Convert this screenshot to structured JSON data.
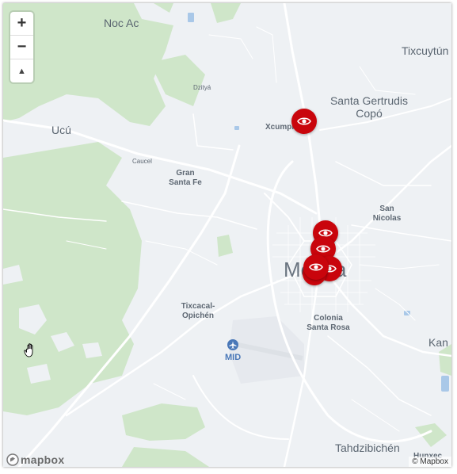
{
  "map": {
    "places": {
      "noc_ac": "Noc Ac",
      "tixcuytun": "Tixcuytún",
      "dzitya": "Dzityá",
      "santa_gertrudis": "Santa Gertrudis Copó",
      "xcumpich": "Xcumpich",
      "ucu": "Ucú",
      "caucel": "Caucel",
      "gran_santa_fe": "Gran Santa Fe",
      "san_nicolas": "San Nicolas",
      "merida": "Mérida",
      "tixcacal": "Tixcacal-Opichén",
      "colonia_santa_rosa": "Colonia Santa Rosa",
      "kan": "Kan",
      "airport": "MID",
      "tahdzibichen": "Tahdzibichén",
      "hunxectaman": "Hunxec"
    },
    "markers_count": 5,
    "marker_color": "#c9050c",
    "water_color": "#a9c8e8",
    "park_color": "#cfe6c9",
    "land_color": "#eef1f4"
  },
  "controls": {
    "zoom_in": "+",
    "zoom_out": "−",
    "compass": "▲"
  },
  "branding": {
    "logo": "mapbox",
    "attribution": "© Mapbox"
  }
}
